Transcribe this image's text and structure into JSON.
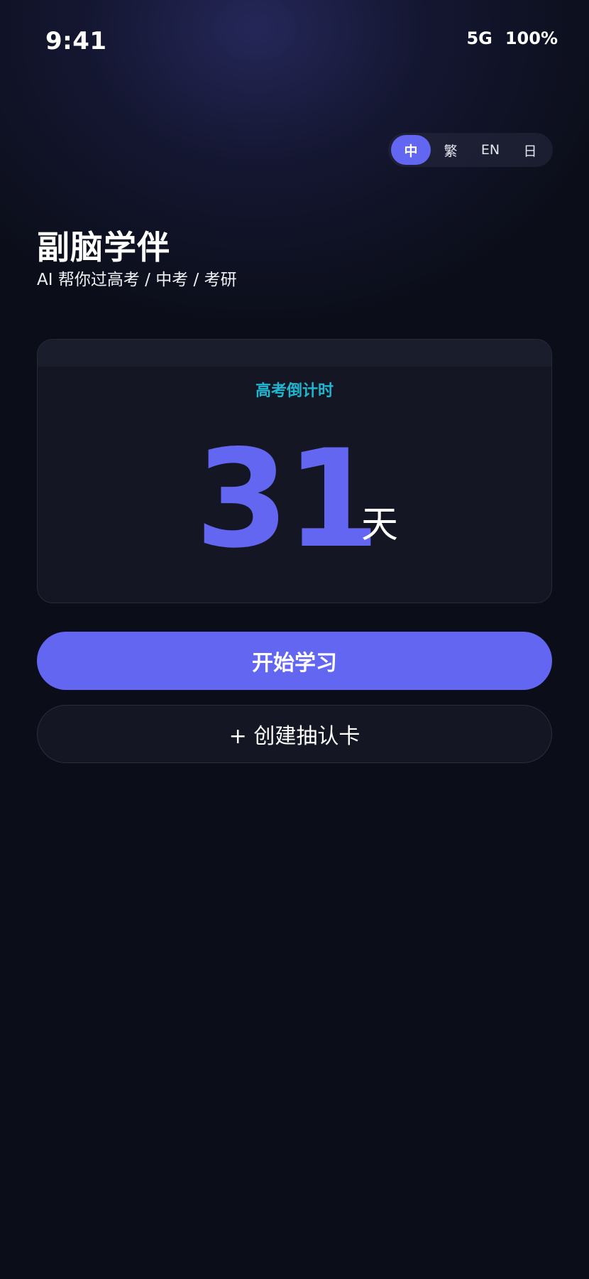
{
  "status_bar": {
    "time": "9:41",
    "network": "5G",
    "battery": "100%"
  },
  "language_switcher": {
    "options": [
      "中",
      "繁",
      "EN",
      "日"
    ],
    "selected": "中"
  },
  "header": {
    "title": "副脑学伴",
    "subtitle": "AI 帮你过高考 / 中考 / 考研"
  },
  "countdown": {
    "label": "高考倒计时",
    "days": "31",
    "unit": "天"
  },
  "actions": {
    "start_label": "开始学习",
    "create_card_label": "+ 创建抽认卡"
  },
  "colors": {
    "accent": "#6366f1",
    "countdown_label": "#1fb6d1",
    "background": "#0b0e19",
    "card": "#141723"
  }
}
